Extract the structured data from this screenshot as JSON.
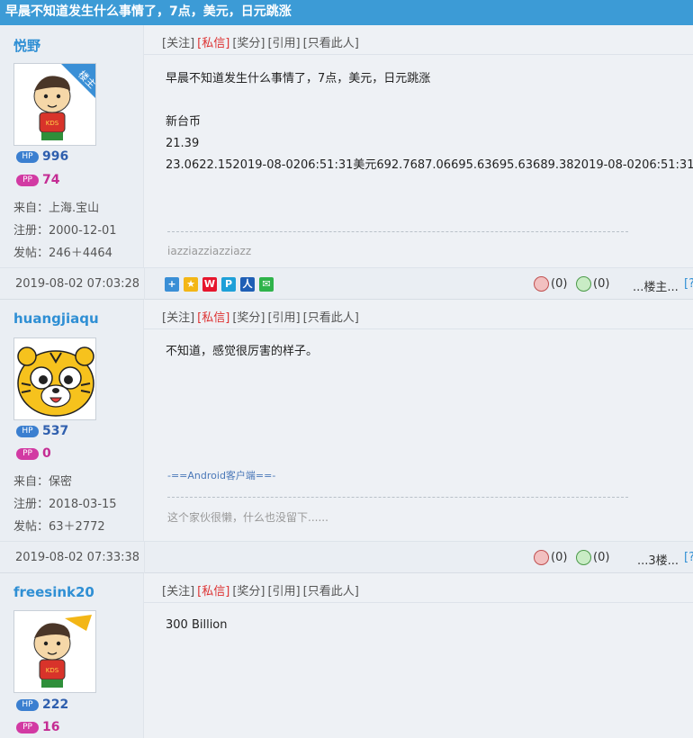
{
  "thread": {
    "title": "早晨不知道发生什么事情了，7点，美元，日元跳涨"
  },
  "action_bar": {
    "follow": "[关注]",
    "pm": "[私信]",
    "reward": "[奖分]",
    "quote": "[引用]",
    "only_this": "[只看此人]"
  },
  "posts": [
    {
      "username": "悦野",
      "owner_badge": "楼主",
      "hp_label": "HP",
      "hp": "996",
      "pp_label": "PP",
      "pp": "74",
      "from": "来自：上海.宝山",
      "registered": "注册：2000-12-01",
      "posts": "发帖：246＋4464",
      "content_lines": [
        "早晨不知道发生什么事情了，7点，美元，日元跳涨",
        "",
        "新台币",
        "21.39",
        "23.0622.152019-08-0206:51:31美元692.7687.06695.63695.63689.382019-08-0206:51:31"
      ],
      "signature": "iazziazziazziazz",
      "date": "2019-08-02 07:03:28",
      "up": "(0)",
      "down": "(0)",
      "floor": "...楼主..."
    },
    {
      "username": "huangjiaqu",
      "hp_label": "HP",
      "hp": "537",
      "pp_label": "PP",
      "pp": "0",
      "from": "来自：保密",
      "registered": "注册：2018-03-15",
      "posts": "发帖：63＋2772",
      "content_lines": [
        "不知道，感觉很厉害的样子。"
      ],
      "client_tag": "-==Android客户端==-",
      "signature": "这个家伙很懒，什么也没留下......",
      "date": "2019-08-02 07:33:38",
      "up": "(0)",
      "down": "(0)",
      "floor": "...3楼..."
    },
    {
      "username": "freesink20",
      "hp_label": "HP",
      "hp": "222",
      "pp_label": "PP",
      "pp": "16",
      "content_lines": [
        "300 Billion"
      ]
    }
  ],
  "edge_link": "[?"
}
